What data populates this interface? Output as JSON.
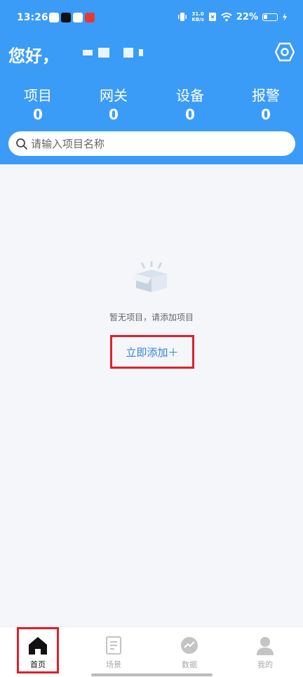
{
  "status_bar": {
    "time": "13:26",
    "speed_top": "31.0",
    "speed_bottom": "KB/s",
    "battery": "22%"
  },
  "header": {
    "greeting": "您好，",
    "settings_icon": "hexagon-settings-icon"
  },
  "stats": [
    {
      "label": "项目",
      "value": "0"
    },
    {
      "label": "网关",
      "value": "0"
    },
    {
      "label": "设备",
      "value": "0"
    },
    {
      "label": "报警",
      "value": "0"
    }
  ],
  "search": {
    "placeholder": "请输入项目名称"
  },
  "empty": {
    "message": "暂无项目，请添加项目",
    "add_label": "立即添加＋"
  },
  "tabs": [
    {
      "label": "首页",
      "icon": "home-icon",
      "active": true
    },
    {
      "label": "场景",
      "icon": "document-icon",
      "active": false
    },
    {
      "label": "数据",
      "icon": "chart-icon",
      "active": false
    },
    {
      "label": "我的",
      "icon": "person-icon",
      "active": false
    }
  ],
  "colors": {
    "primary": "#3a9cf7",
    "accent_text": "#2f86d6",
    "highlight_border": "#e0202a"
  }
}
